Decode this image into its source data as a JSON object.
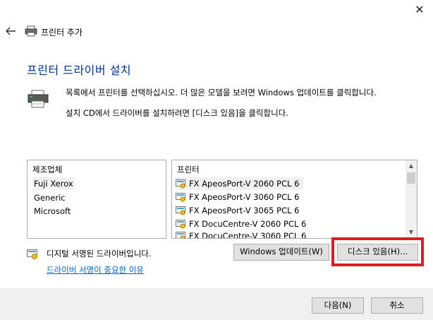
{
  "window": {
    "close_symbol": "✕",
    "title": "프린터 추가"
  },
  "page": {
    "heading": "프린터 드라이버 설치",
    "desc1": "목록에서 프린터를 선택하십시오. 더 많은 모델을 보려면 Windows 업데이트를 클릭합니다.",
    "desc2": "설치 CD에서 드라이버를 설치하려면 [디스크 있음]을 클릭합니다."
  },
  "manufacturers": {
    "header": "제조업체",
    "items": [
      "Fuji Xerox",
      "Generic",
      "Microsoft"
    ],
    "selected": "Fuji Xerox"
  },
  "printers": {
    "header": "프린터",
    "items": [
      "FX ApeosPort-V 2060 PCL 6",
      "FX ApeosPort-V 3060 PCL 6",
      "FX ApeosPort-V 3065 PCL 6",
      "FX DocuCentre-V 2060 PCL 6",
      "FX DocuCentre-V 3060 PCL 6"
    ],
    "selected": "FX ApeosPort-V 2060 PCL 6"
  },
  "signature": {
    "text": "디지털 서명된 드라이버입니다.",
    "link": "드라이버 서명이 중요한 이유"
  },
  "buttons": {
    "windows_update": "Windows 업데이트(W)",
    "have_disk": "디스크 있음(H)...",
    "next": "다음(N)",
    "cancel": "취소"
  },
  "colors": {
    "heading": "#003399",
    "link": "#0066cc",
    "highlight": "#e01b24"
  }
}
